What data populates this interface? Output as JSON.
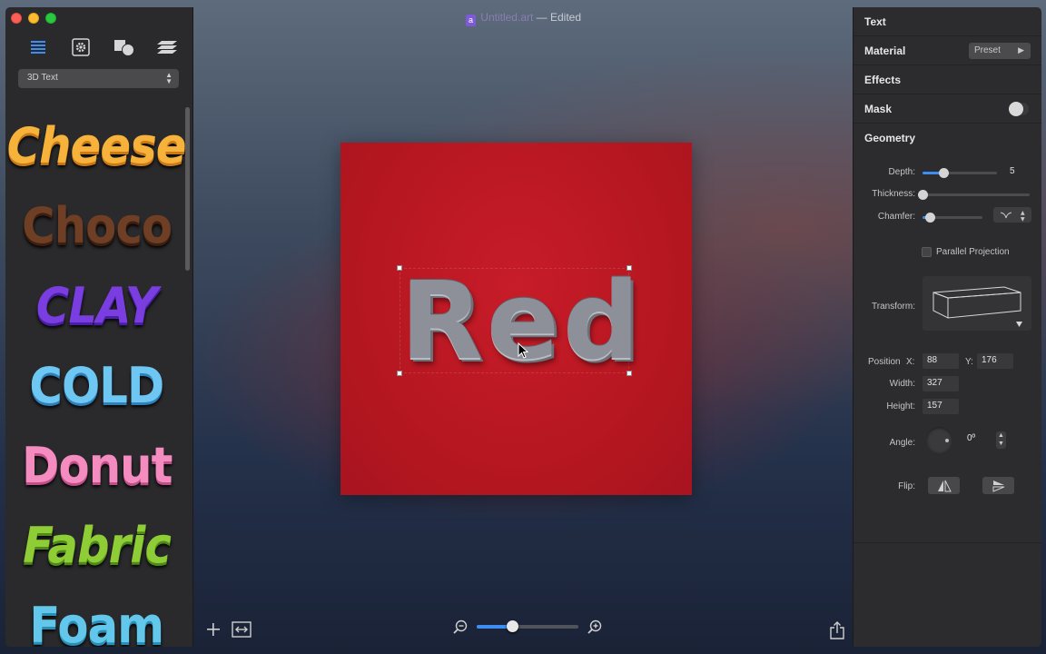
{
  "window": {
    "title_doc": "Untitled.art",
    "title_status": "— Edited"
  },
  "sidebar": {
    "tools": [
      "list-icon",
      "gear-icon",
      "shapes-icon",
      "layers-icon"
    ],
    "category": "3D Text",
    "styles": [
      "Cheese",
      "Choco",
      "CLAY",
      "COLD",
      "Donut",
      "Fabric",
      "Foam"
    ]
  },
  "canvas": {
    "text": "Red",
    "artboard_color": "#b3161f",
    "zoom_level": 0.35
  },
  "inspector": {
    "sections": {
      "text": "Text",
      "material": "Material",
      "preset": "Preset",
      "effects": "Effects",
      "mask": "Mask",
      "geometry": "Geometry"
    },
    "geometry": {
      "depth_label": "Depth:",
      "depth_value": "5",
      "depth_level": 0.28,
      "thickness_label": "Thickness:",
      "thickness_level": 0.0,
      "chamfer_label": "Chamfer:",
      "chamfer_level": 0.12,
      "parallel_label": "Parallel Projection",
      "parallel_checked": false,
      "transform_label": "Transform:",
      "position_label": "Position",
      "x_label": "X:",
      "x_value": "88",
      "y_label": "Y:",
      "y_value": "176",
      "width_label": "Width:",
      "width_value": "327",
      "height_label": "Height:",
      "height_value": "157",
      "angle_label": "Angle:",
      "angle_value": "0º",
      "flip_label": "Flip:"
    },
    "accent": "#3d8ef0"
  }
}
